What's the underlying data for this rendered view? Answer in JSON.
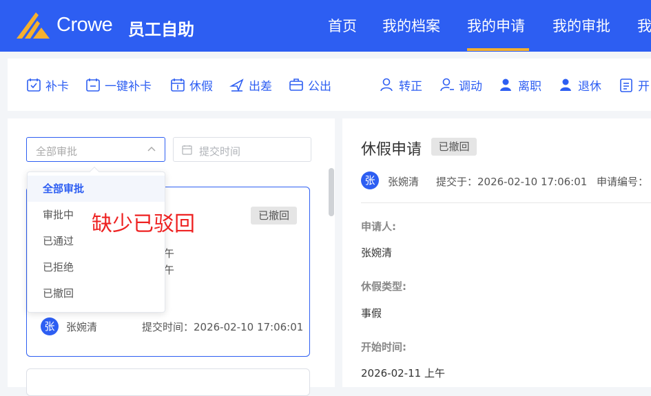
{
  "header": {
    "brand": "Crowe",
    "app_title": "员工自助",
    "nav": [
      "首页",
      "我的档案",
      "我的申请",
      "我的审批",
      "我"
    ],
    "active_nav": "我的申请",
    "accent_color": "#f5b02e"
  },
  "actions": [
    {
      "label": "补卡",
      "icon": "calendar-check-icon"
    },
    {
      "label": "一键补卡",
      "icon": "calendar-check-icon"
    },
    {
      "label": "休假",
      "icon": "calendar-leave-icon"
    },
    {
      "label": "出差",
      "icon": "airplane-icon"
    },
    {
      "label": "公出",
      "icon": "briefcase-icon"
    },
    {
      "label": "转正",
      "icon": "user-icon"
    },
    {
      "label": "调动",
      "icon": "user-transfer-icon"
    },
    {
      "label": "离职",
      "icon": "user-leave-icon"
    },
    {
      "label": "退休",
      "icon": "user-retire-icon"
    },
    {
      "label": "开",
      "icon": "clipboard-icon"
    }
  ],
  "filter": {
    "status_value": "全部审批",
    "date_placeholder": "提交时间",
    "options": [
      "全部审批",
      "审批中",
      "已通过",
      "已拒绝",
      "已撤回"
    ],
    "selected": "全部审批"
  },
  "annotation": "缺少已驳回",
  "card": {
    "badge": "已撤回",
    "fragments": [
      "午",
      "午"
    ],
    "avatar": "张",
    "user": "张婉清",
    "submit_time": "提交时间：2026-02-10 17:06:01"
  },
  "detail": {
    "title": "休假申请",
    "badge": "已撤回",
    "avatar": "张",
    "user": "张婉清",
    "submitted": "提交于：2026-02-10 17:06:01",
    "app_no_label": "申请编号：",
    "fields": [
      {
        "label": "申请人:",
        "value": "张婉清"
      },
      {
        "label": "休假类型:",
        "value": "事假"
      },
      {
        "label": "开始时间:",
        "value": "2026-02-11 上午"
      }
    ]
  },
  "colors": {
    "primary": "#2d5ef2",
    "annotation": "#ee2222"
  }
}
